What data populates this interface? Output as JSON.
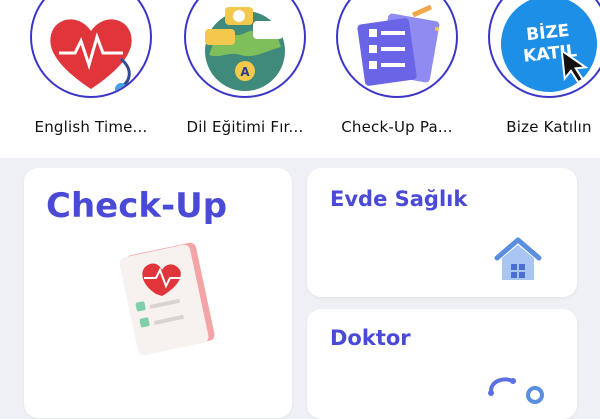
{
  "stories": [
    {
      "label": "English Time...",
      "icon": "heart-pulse-icon"
    },
    {
      "label": "Dil Eğitimi Fır...",
      "icon": "globe-language-icon"
    },
    {
      "label": "Check-Up Pa...",
      "icon": "checklist-icon"
    },
    {
      "label": "Bize Katılın",
      "icon": "join-us-badge-icon",
      "badge_line1": "BİZE",
      "badge_line2": "KATIL"
    }
  ],
  "cards": {
    "checkup": {
      "title": "Check-Up",
      "icon": "medical-report-heart-icon"
    },
    "home_health": {
      "title": "Evde Sağlık",
      "icon": "house-icon"
    },
    "doctor": {
      "title": "Doktor",
      "icon": "stethoscope-icon"
    }
  },
  "colors": {
    "accent": "#4a4ad6",
    "ring": "#3b36c7",
    "join_blue": "#1e8fe6",
    "background": "#eef0f6"
  }
}
